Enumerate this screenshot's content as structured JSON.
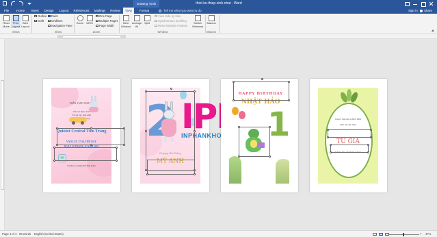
{
  "window": {
    "drawing_tools_label": "Drawing Tools",
    "document_title": "thiet-ke-thiep-sinh-nhat - Word",
    "sign_in": "Sign in",
    "share": "Share"
  },
  "tabs": [
    {
      "label": "File"
    },
    {
      "label": "Home"
    },
    {
      "label": "Insert"
    },
    {
      "label": "Design"
    },
    {
      "label": "Layout"
    },
    {
      "label": "References"
    },
    {
      "label": "Mailings"
    },
    {
      "label": "Review"
    },
    {
      "label": "View"
    },
    {
      "label": "Format"
    }
  ],
  "tell_me": "Tell me what you want to do",
  "ribbon": {
    "views": {
      "read_mode": "Read Mode",
      "print_layout": "Print Layout",
      "web_layout": "Web Layout",
      "group_label": "Views"
    },
    "show": {
      "ruler": "Ruler",
      "gridlines": "Gridlines",
      "navigation_pane": "Navigation Pane",
      "outline": "Outline",
      "draft": "Draft",
      "group_label": "Show"
    },
    "zoom": {
      "zoom": "Zoom",
      "percent": "100%",
      "one_page": "One Page",
      "multiple_pages": "Multiple Pages",
      "page_width": "Page Width",
      "group_label": "Zoom"
    },
    "window": {
      "new_window": "New Window",
      "arrange_all": "Arrange All",
      "split": "Split",
      "view_side_by_side": "View Side by Side",
      "synchronous_scrolling": "Synchronous Scrolling",
      "reset_window_position": "Reset Window Position",
      "switch_windows": "Switch Windows",
      "group_label": "Window"
    },
    "macros": {
      "macros": "Macros",
      "group_label": "Macros"
    }
  },
  "pages": {
    "card1": {
      "line1": "THÂN TẶNG CHA MẸ",
      "line2": "Rất vui được mời",
      "line3": "Tới dự tiệc sinh nhật",
      "line4": "Của bé Tiến Trang",
      "name": "Quintet Central Tiến Trang",
      "detail1": "VÀO LÚC 17:30, THỨ BẢY",
      "detail2": "NGÀY 22 THÁNG 11 NĂM 2023",
      "footer": "Ủy Ban Gia Đình Rất Hân Hạnh"
    },
    "card2": {
      "numeral": "2",
      "name": "MỸ ANH",
      "script": "Happy Birthday"
    },
    "card3": {
      "happy": "HAPPY BIRTHDAY",
      "name": "NHẬT HẢO",
      "numeral": "1"
    },
    "card4": {
      "line1": "TRÂN TRỌNG KÍNH MỜI",
      "line2": "Đến dự sinh nhật",
      "name": "TÚ GIA",
      "detail": "VÀO LÚC 17:30 NGÀY 21"
    },
    "watermark": {
      "brand": "IPK",
      "url": "INPHANKHOI.COM"
    }
  },
  "statusbar": {
    "page": "Page 4 of 4",
    "words": "59 words",
    "language": "English (United States)",
    "zoom_percent": "47%"
  },
  "colors": {
    "word_blue": "#2b579a",
    "card_pink": "#fbd9e6",
    "card_green": "#e8f2a8",
    "watermark_pink": "#e8198b",
    "watermark_blue": "#1f7fc7"
  }
}
